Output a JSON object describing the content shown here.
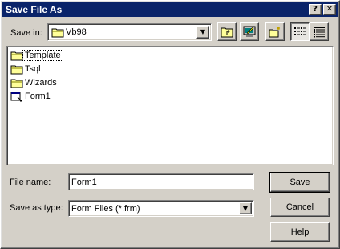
{
  "window": {
    "title": "Save File As",
    "help_button": "?",
    "close_button": "✕"
  },
  "save_in": {
    "label": "Save in:",
    "value": "Vb98",
    "icon": "folder-icon"
  },
  "toolbar": {
    "icons": [
      "up-one-level-icon",
      "desktop-icon",
      "new-folder-icon",
      "list-view-icon",
      "details-view-icon"
    ]
  },
  "files": [
    {
      "name": "Template",
      "icon": "folder-icon",
      "selected": true
    },
    {
      "name": "Tsql",
      "icon": "folder-icon",
      "selected": false
    },
    {
      "name": "Wizards",
      "icon": "folder-icon",
      "selected": false
    },
    {
      "name": "Form1",
      "icon": "form-file-icon",
      "selected": false
    }
  ],
  "file_name": {
    "label": "File name:",
    "value": "Form1"
  },
  "save_as_type": {
    "label": "Save as type:",
    "value": "Form Files (*.frm)"
  },
  "buttons": {
    "save": "Save",
    "cancel": "Cancel",
    "help": "Help"
  },
  "colors": {
    "title_bar": "#0a246a",
    "face": "#d4d0c8",
    "folder": "#ffff99"
  }
}
